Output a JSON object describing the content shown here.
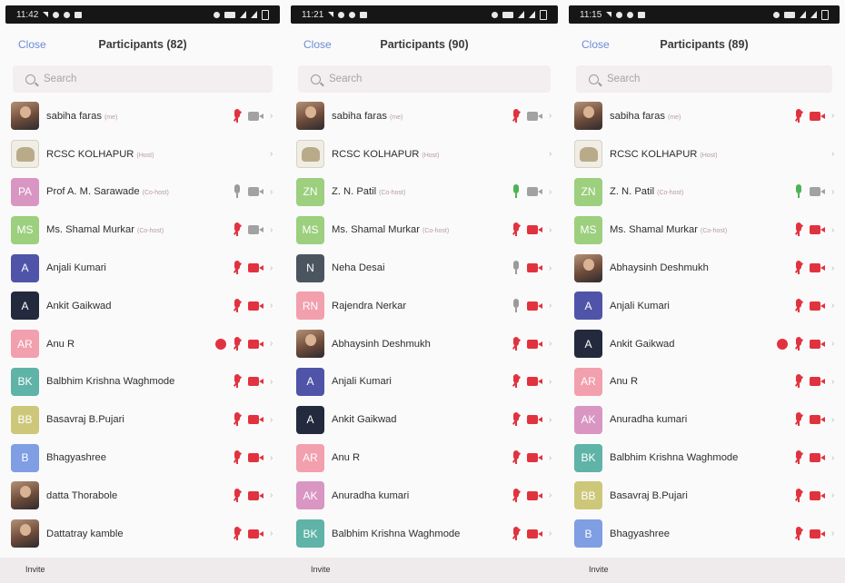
{
  "screens": [
    {
      "time": "11:42",
      "close_label": "Close",
      "title": "Participants (82)",
      "search_placeholder": "Search",
      "invite_label": "Invite",
      "participants": [
        {
          "name": "sabiha faras",
          "role": "(me)",
          "avatar": "photo",
          "mic": "muted",
          "cam": "on",
          "initials": ""
        },
        {
          "name": "RCSC KOLHAPUR",
          "role": "(Host)",
          "avatar": "logo",
          "mic": "none",
          "cam": "none",
          "initials": ""
        },
        {
          "name": "Prof A. M. Sarawade",
          "role": "(Co-host)",
          "avatar": "#d996c2",
          "mic": "on",
          "cam": "on",
          "initials": "PA"
        },
        {
          "name": "Ms. Shamal Murkar",
          "role": "(Co-host)",
          "avatar": "#9ccf7e",
          "mic": "muted",
          "cam": "on",
          "initials": "MS"
        },
        {
          "name": "Anjali Kumari",
          "role": "",
          "avatar": "#4f54a8",
          "mic": "muted",
          "cam": "off",
          "initials": "A"
        },
        {
          "name": "Ankit Gaikwad",
          "role": "",
          "avatar": "#232a3d",
          "mic": "muted",
          "cam": "off",
          "initials": "A"
        },
        {
          "name": "Anu R",
          "role": "",
          "avatar": "#f29fae",
          "mic": "muted",
          "cam": "off",
          "initials": "AR",
          "raise": true
        },
        {
          "name": "Balbhim Krishna Waghmode",
          "role": "",
          "avatar": "#5fb3a7",
          "mic": "muted",
          "cam": "off",
          "initials": "BK"
        },
        {
          "name": "Basavraj B.Pujari",
          "role": "",
          "avatar": "#cdc77a",
          "mic": "muted",
          "cam": "off",
          "initials": "BB"
        },
        {
          "name": "Bhagyashree",
          "role": "",
          "avatar": "#7f9ee3",
          "mic": "muted",
          "cam": "off",
          "initials": "B"
        },
        {
          "name": "datta Thorabole",
          "role": "",
          "avatar": "photo",
          "mic": "muted",
          "cam": "off",
          "initials": ""
        },
        {
          "name": "Dattatray kamble",
          "role": "",
          "avatar": "photo",
          "mic": "muted",
          "cam": "off",
          "initials": ""
        }
      ]
    },
    {
      "time": "11:21",
      "close_label": "Close",
      "title": "Participants (90)",
      "search_placeholder": "Search",
      "invite_label": "Invite",
      "participants": [
        {
          "name": "sabiha faras",
          "role": "(me)",
          "avatar": "photo",
          "mic": "muted",
          "cam": "on",
          "initials": ""
        },
        {
          "name": "RCSC KOLHAPUR",
          "role": "(Host)",
          "avatar": "logo",
          "mic": "none",
          "cam": "none",
          "initials": ""
        },
        {
          "name": "Z. N. Patil",
          "role": "(Co-host)",
          "avatar": "#9ccf7e",
          "mic": "green",
          "cam": "on",
          "initials": "ZN"
        },
        {
          "name": "Ms. Shamal Murkar",
          "role": "(Co-host)",
          "avatar": "#9ccf7e",
          "mic": "muted",
          "cam": "off",
          "initials": "MS"
        },
        {
          "name": "Neha Desai",
          "role": "",
          "avatar": "#4a5560",
          "mic": "on",
          "cam": "off",
          "initials": "N"
        },
        {
          "name": "Rajendra Nerkar",
          "role": "",
          "avatar": "#f29fae",
          "mic": "on",
          "cam": "off",
          "initials": "RN"
        },
        {
          "name": "Abhaysinh Deshmukh",
          "role": "",
          "avatar": "photo",
          "mic": "muted",
          "cam": "off",
          "initials": ""
        },
        {
          "name": "Anjali Kumari",
          "role": "",
          "avatar": "#4f54a8",
          "mic": "muted",
          "cam": "off",
          "initials": "A"
        },
        {
          "name": "Ankit Gaikwad",
          "role": "",
          "avatar": "#232a3d",
          "mic": "muted",
          "cam": "off",
          "initials": "A"
        },
        {
          "name": "Anu R",
          "role": "",
          "avatar": "#f29fae",
          "mic": "muted",
          "cam": "off",
          "initials": "AR"
        },
        {
          "name": "Anuradha kumari",
          "role": "",
          "avatar": "#d996c2",
          "mic": "muted",
          "cam": "off",
          "initials": "AK"
        },
        {
          "name": "Balbhim Krishna Waghmode",
          "role": "",
          "avatar": "#5fb3a7",
          "mic": "muted",
          "cam": "off",
          "initials": "BK"
        }
      ]
    },
    {
      "time": "11:15",
      "close_label": "Close",
      "title": "Participants (89)",
      "search_placeholder": "Search",
      "invite_label": "Invite",
      "participants": [
        {
          "name": "sabiha faras",
          "role": "(me)",
          "avatar": "photo",
          "mic": "muted",
          "cam": "off",
          "initials": ""
        },
        {
          "name": "RCSC KOLHAPUR",
          "role": "(Host)",
          "avatar": "logo",
          "mic": "none",
          "cam": "none",
          "initials": ""
        },
        {
          "name": "Z. N. Patil",
          "role": "(Co-host)",
          "avatar": "#9ccf7e",
          "mic": "green",
          "cam": "on",
          "initials": "ZN"
        },
        {
          "name": "Ms. Shamal Murkar",
          "role": "(Co-host)",
          "avatar": "#9ccf7e",
          "mic": "muted",
          "cam": "off",
          "initials": "MS"
        },
        {
          "name": "Abhaysinh Deshmukh",
          "role": "",
          "avatar": "photo",
          "mic": "muted",
          "cam": "off",
          "initials": ""
        },
        {
          "name": "Anjali Kumari",
          "role": "",
          "avatar": "#4f54a8",
          "mic": "muted",
          "cam": "off",
          "initials": "A"
        },
        {
          "name": "Ankit Gaikwad",
          "role": "",
          "avatar": "#232a3d",
          "mic": "muted",
          "cam": "off",
          "initials": "A",
          "raise": true
        },
        {
          "name": "Anu R",
          "role": "",
          "avatar": "#f29fae",
          "mic": "muted",
          "cam": "off",
          "initials": "AR"
        },
        {
          "name": "Anuradha kumari",
          "role": "",
          "avatar": "#d996c2",
          "mic": "muted",
          "cam": "off",
          "initials": "AK"
        },
        {
          "name": "Balbhim Krishna Waghmode",
          "role": "",
          "avatar": "#5fb3a7",
          "mic": "muted",
          "cam": "off",
          "initials": "BK"
        },
        {
          "name": "Basavraj B.Pujari",
          "role": "",
          "avatar": "#cdc77a",
          "mic": "muted",
          "cam": "off",
          "initials": "BB"
        },
        {
          "name": "Bhagyashree",
          "role": "",
          "avatar": "#7f9ee3",
          "mic": "muted",
          "cam": "off",
          "initials": "B"
        }
      ]
    }
  ]
}
